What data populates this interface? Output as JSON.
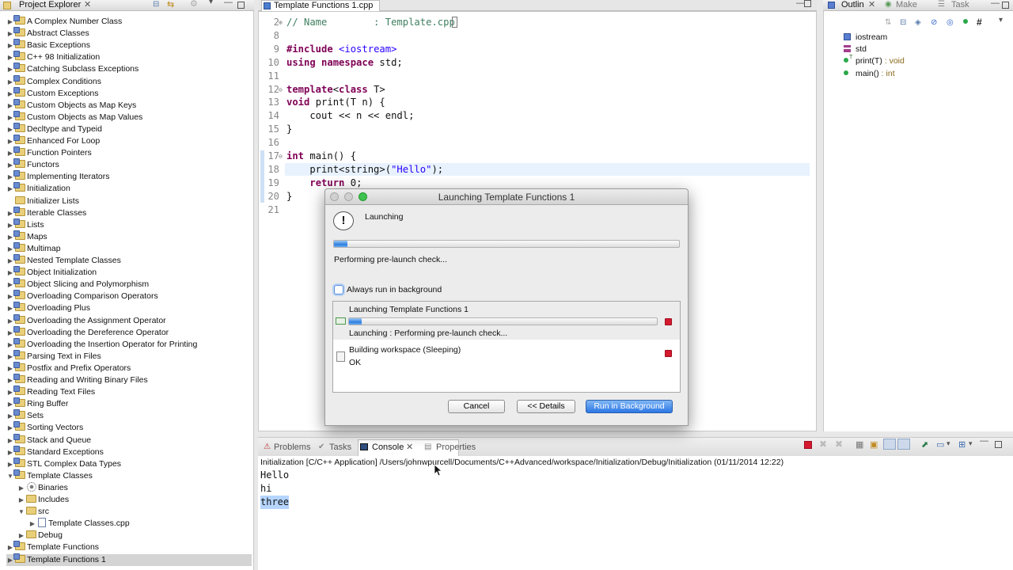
{
  "project_explorer": {
    "title": "Project Explorer",
    "items": [
      {
        "label": "A Complex Number Class",
        "level": 0,
        "expanded": false,
        "icon": "project-folder-icon"
      },
      {
        "label": "Abstract Classes",
        "level": 0,
        "expanded": false,
        "icon": "project-folder-icon"
      },
      {
        "label": "Basic Exceptions",
        "level": 0,
        "expanded": false,
        "icon": "project-folder-icon"
      },
      {
        "label": "C++ 98 Initialization",
        "level": 0,
        "expanded": false,
        "icon": "project-folder-icon"
      },
      {
        "label": "Catching Subclass Exceptions",
        "level": 0,
        "expanded": false,
        "icon": "project-folder-icon"
      },
      {
        "label": "Complex Conditions",
        "level": 0,
        "expanded": false,
        "icon": "project-folder-icon"
      },
      {
        "label": "Custom Exceptions",
        "level": 0,
        "expanded": false,
        "icon": "project-folder-icon"
      },
      {
        "label": "Custom Objects as Map Keys",
        "level": 0,
        "expanded": false,
        "icon": "project-folder-icon"
      },
      {
        "label": "Custom Objects as Map Values",
        "level": 0,
        "expanded": false,
        "icon": "project-folder-icon"
      },
      {
        "label": "Decltype and Typeid",
        "level": 0,
        "expanded": false,
        "icon": "project-folder-icon"
      },
      {
        "label": "Enhanced For Loop",
        "level": 0,
        "expanded": false,
        "icon": "project-folder-icon"
      },
      {
        "label": "Function Pointers",
        "level": 0,
        "expanded": false,
        "icon": "project-folder-icon"
      },
      {
        "label": "Functors",
        "level": 0,
        "expanded": false,
        "icon": "project-folder-icon"
      },
      {
        "label": "Implementing Iterators",
        "level": 0,
        "expanded": false,
        "icon": "project-folder-icon"
      },
      {
        "label": "Initialization",
        "level": 0,
        "expanded": false,
        "icon": "project-folder-icon"
      },
      {
        "label": "Initializer Lists",
        "level": 0,
        "expanded": null,
        "icon": "folder-icon"
      },
      {
        "label": "Iterable Classes",
        "level": 0,
        "expanded": false,
        "icon": "project-folder-icon"
      },
      {
        "label": "Lists",
        "level": 0,
        "expanded": false,
        "icon": "project-folder-icon"
      },
      {
        "label": "Maps",
        "level": 0,
        "expanded": false,
        "icon": "project-folder-icon"
      },
      {
        "label": "Multimap",
        "level": 0,
        "expanded": false,
        "icon": "project-folder-icon"
      },
      {
        "label": "Nested Template Classes",
        "level": 0,
        "expanded": false,
        "icon": "project-folder-icon"
      },
      {
        "label": "Object Initialization",
        "level": 0,
        "expanded": false,
        "icon": "project-folder-icon"
      },
      {
        "label": "Object Slicing and Polymorphism",
        "level": 0,
        "expanded": false,
        "icon": "project-folder-icon"
      },
      {
        "label": "Overloading Comparison Operators",
        "level": 0,
        "expanded": false,
        "icon": "project-folder-icon"
      },
      {
        "label": "Overloading Plus",
        "level": 0,
        "expanded": false,
        "icon": "project-folder-icon"
      },
      {
        "label": "Overloading the Assignment Operator",
        "level": 0,
        "expanded": false,
        "icon": "project-folder-icon"
      },
      {
        "label": "Overloading the Dereference Operator",
        "level": 0,
        "expanded": false,
        "icon": "project-folder-icon"
      },
      {
        "label": "Overloading the Insertion Operator for Printing",
        "level": 0,
        "expanded": false,
        "icon": "project-folder-icon"
      },
      {
        "label": "Parsing Text in Files",
        "level": 0,
        "expanded": false,
        "icon": "project-folder-icon"
      },
      {
        "label": "Postfix and Prefix Operators",
        "level": 0,
        "expanded": false,
        "icon": "project-folder-icon"
      },
      {
        "label": "Reading and Writing Binary Files",
        "level": 0,
        "expanded": false,
        "icon": "project-folder-icon"
      },
      {
        "label": "Reading Text Files",
        "level": 0,
        "expanded": false,
        "icon": "project-folder-icon"
      },
      {
        "label": "Ring Buffer",
        "level": 0,
        "expanded": false,
        "icon": "project-folder-icon"
      },
      {
        "label": "Sets",
        "level": 0,
        "expanded": false,
        "icon": "project-folder-icon"
      },
      {
        "label": "Sorting Vectors",
        "level": 0,
        "expanded": false,
        "icon": "project-folder-icon"
      },
      {
        "label": "Stack and Queue",
        "level": 0,
        "expanded": false,
        "icon": "project-folder-icon"
      },
      {
        "label": "Standard Exceptions",
        "level": 0,
        "expanded": false,
        "icon": "project-folder-icon"
      },
      {
        "label": "STL Complex Data Types",
        "level": 0,
        "expanded": false,
        "icon": "project-folder-icon"
      },
      {
        "label": "Template Classes",
        "level": 0,
        "expanded": true,
        "icon": "project-folder-icon"
      },
      {
        "label": "Binaries",
        "level": 1,
        "expanded": false,
        "icon": "binaries-icon"
      },
      {
        "label": "Includes",
        "level": 1,
        "expanded": false,
        "icon": "includes-icon"
      },
      {
        "label": "src",
        "level": 1,
        "expanded": true,
        "icon": "source-folder-icon"
      },
      {
        "label": "Template Classes.cpp",
        "level": 2,
        "expanded": false,
        "icon": "cpp-file-icon"
      },
      {
        "label": "Debug",
        "level": 1,
        "expanded": false,
        "icon": "folder-icon"
      },
      {
        "label": "Template Functions",
        "level": 0,
        "expanded": false,
        "icon": "project-folder-icon"
      },
      {
        "label": "Template Functions 1",
        "level": 0,
        "expanded": false,
        "icon": "project-folder-icon",
        "selected": true
      }
    ]
  },
  "editor": {
    "tab_label": "Template Functions 1.cpp",
    "lines": [
      {
        "num": "2",
        "marker": "⊕",
        "html": "<span class='cm'>// Name        : Template.cpp</span>"
      },
      {
        "num": "8",
        "marker": "",
        "html": ""
      },
      {
        "num": "9",
        "marker": "",
        "html": "<span class='kw'>#include</span> <span class='str'>&lt;iostream&gt;</span>"
      },
      {
        "num": "10",
        "marker": "",
        "html": "<span class='kw'>using namespace</span> std;"
      },
      {
        "num": "11",
        "marker": "",
        "html": ""
      },
      {
        "num": "12",
        "marker": "⊖",
        "html": "<span class='kw'>template</span>&lt;<span class='kw'>class</span> T&gt;"
      },
      {
        "num": "13",
        "marker": "",
        "html": "<span class='kw'>void</span> print(T n) {"
      },
      {
        "num": "14",
        "marker": "",
        "html": "    cout &lt;&lt; n &lt;&lt; endl;"
      },
      {
        "num": "15",
        "marker": "",
        "html": "}"
      },
      {
        "num": "16",
        "marker": "",
        "html": ""
      },
      {
        "num": "17",
        "marker": "⊖",
        "html": "<span class='kw'>int</span> main() {"
      },
      {
        "num": "18",
        "marker": "",
        "html": "    print&lt;string&gt;(<span class='str'>\"Hello\"</span>);"
      },
      {
        "num": "19",
        "marker": "",
        "html": "    <span class='kw'>return</span> 0;"
      },
      {
        "num": "20",
        "marker": "",
        "html": "}"
      },
      {
        "num": "21",
        "marker": "",
        "html": ""
      }
    ]
  },
  "outline": {
    "tabs": [
      "Outlin",
      "Make",
      "Task"
    ],
    "items": [
      {
        "icon": "include-icon",
        "label": "iostream",
        "type": ""
      },
      {
        "icon": "namespace-icon",
        "label": "std",
        "type": ""
      },
      {
        "icon": "function-icon",
        "label": "print(T)",
        "type": " : void",
        "super": "T"
      },
      {
        "icon": "function-icon",
        "label": "main()",
        "type": " : int"
      }
    ]
  },
  "console": {
    "tabs": [
      "Problems",
      "Tasks",
      "Console",
      "Properties"
    ],
    "active_tab": "Console",
    "header": "Initialization [C/C++ Application] /Users/johnwpurcell/Documents/C++Advanced/workspace/Initialization/Debug/Initialization (01/11/2014 12:22)",
    "output": [
      "Hello",
      "hi",
      "three"
    ],
    "highlighted_line": "three"
  },
  "dialog": {
    "title": "Launching Template Functions 1",
    "heading": "Launching",
    "status": "Performing pre-launch check...",
    "overall_progress": 0.04,
    "background_checkbox_label": "Always run in background",
    "background_checked": false,
    "jobs": [
      {
        "name": "Launching Template Functions 1",
        "progress": 0.04,
        "detail": "Launching : Performing pre-launch check..."
      },
      {
        "name": "Building workspace (Sleeping)",
        "detail": "OK"
      }
    ],
    "buttons": {
      "cancel": "Cancel",
      "details": "<< Details",
      "run_bg": "Run in Background"
    }
  },
  "colors": {
    "accent": "#2d78e6",
    "keyword": "#7f0055",
    "string": "#2a00ff",
    "stop": "#d5192e"
  }
}
